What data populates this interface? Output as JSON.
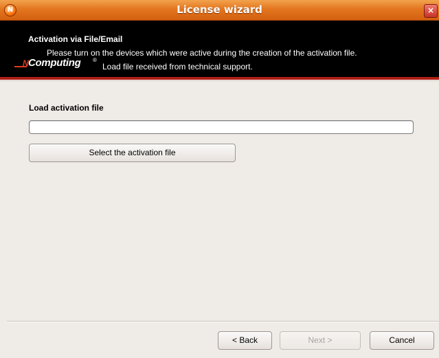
{
  "window": {
    "title": "License wizard",
    "app_icon": "ncomputing-app-icon",
    "close_glyph": "×"
  },
  "banner": {
    "heading": "Activation via File/Email",
    "line1": "Please turn on the devices which were active during the creation of the activation file.",
    "line2": "Load file received from technical support.",
    "logo": {
      "prefix": "N",
      "word": "Computing",
      "reg": "®"
    }
  },
  "main": {
    "section_label": "Load activation file",
    "file_input": {
      "value": "",
      "placeholder": ""
    },
    "select_button_label": "Select the activation file"
  },
  "footer": {
    "back_label": "< Back",
    "next_label": "Next >",
    "cancel_label": "Cancel",
    "next_disabled": true
  },
  "colors": {
    "titlebar": "#e3761f",
    "banner_bg": "#000000",
    "banner_accent": "#b01f16",
    "dialog_bg": "#efebe7"
  }
}
